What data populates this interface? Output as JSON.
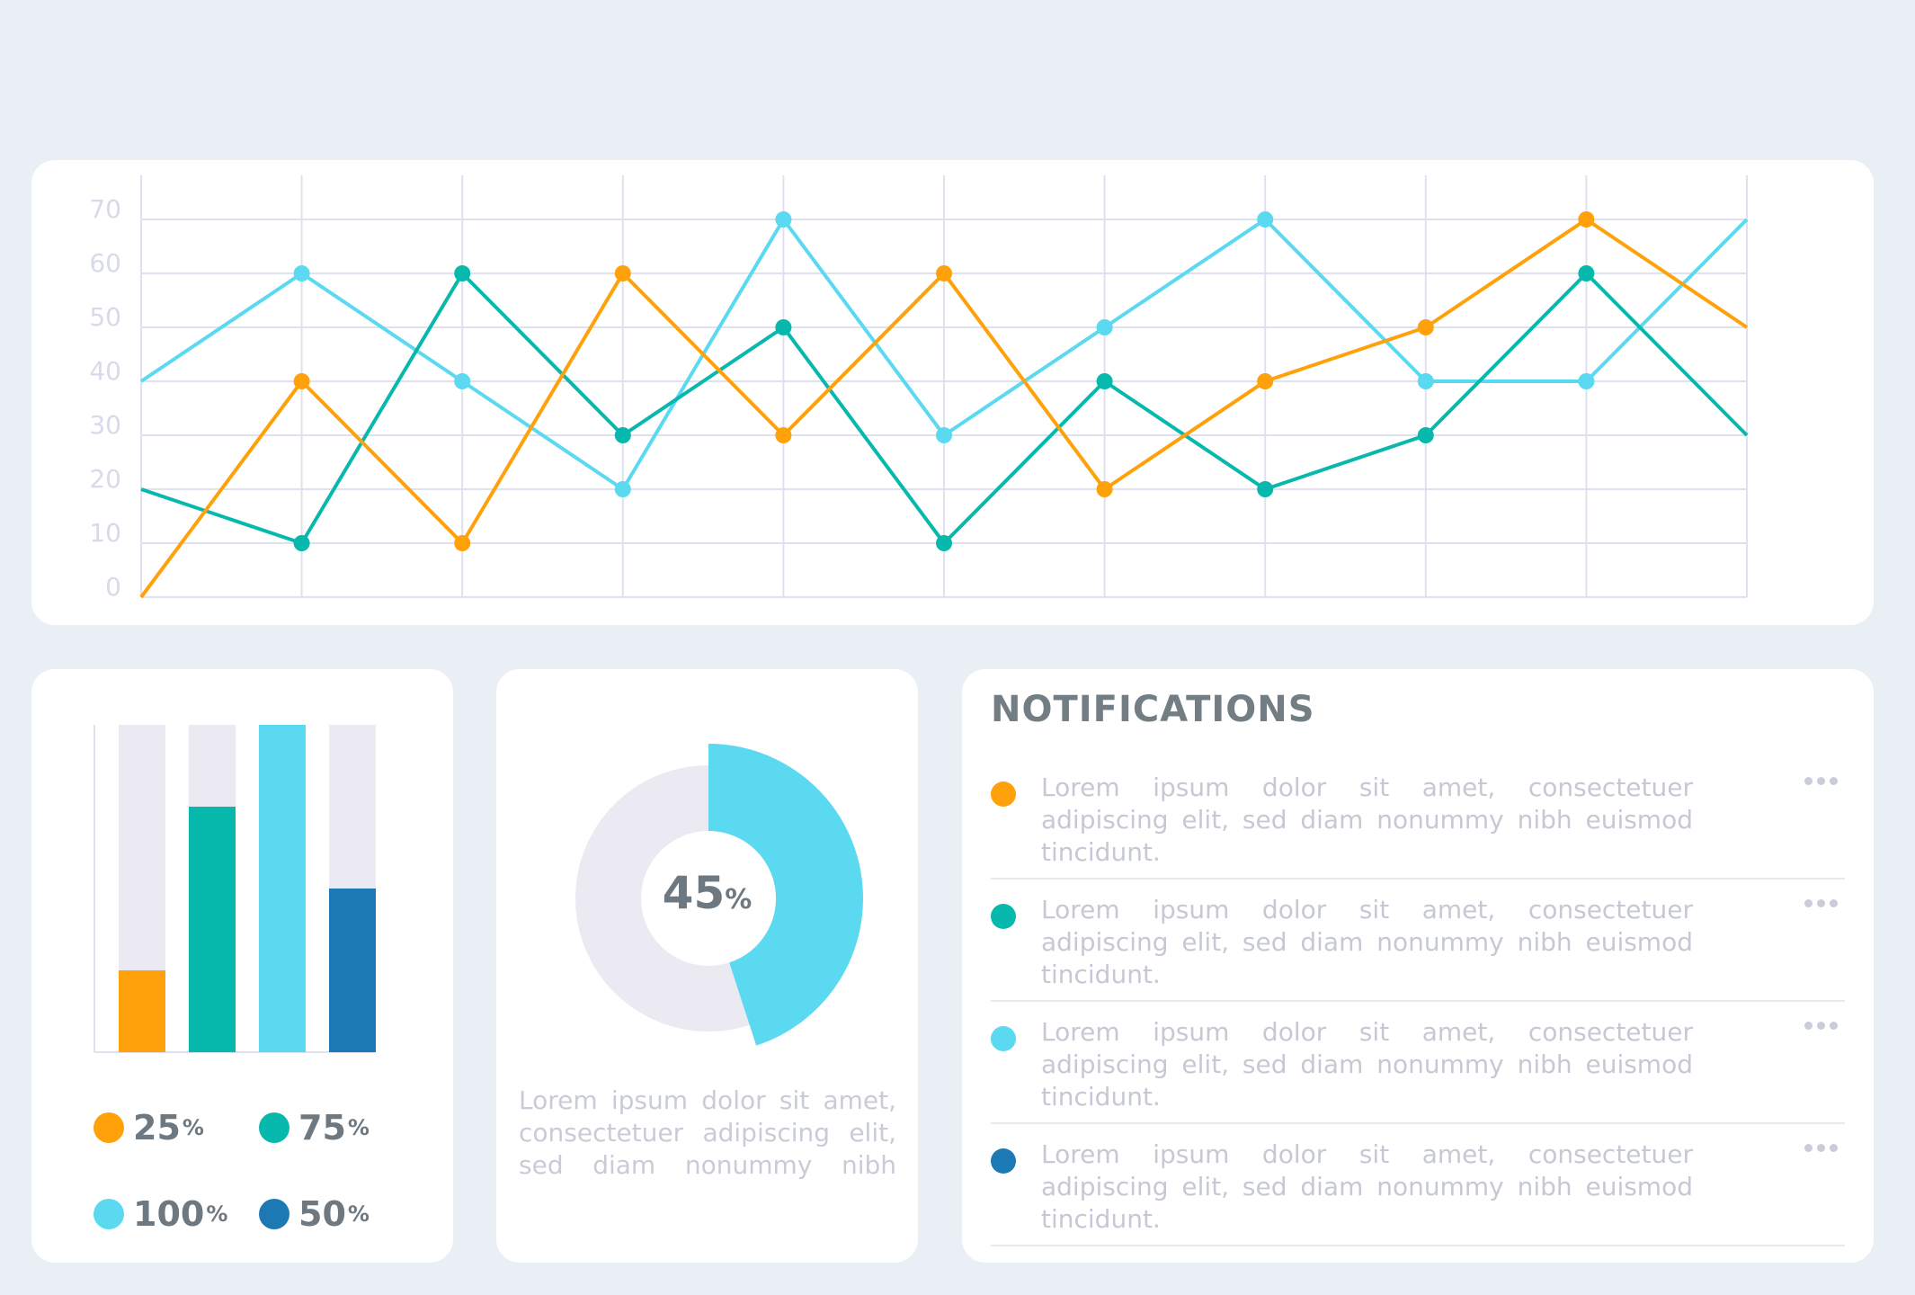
{
  "colors": {
    "background": "#eaeff6",
    "card": "#ffffff",
    "grid": "#dfe1ee",
    "orange": "#ffa10a",
    "teal": "#07b8ad",
    "sky": "#5ad9f1",
    "blue": "#1d79b4",
    "track": "#ebeaf3"
  },
  "chart_data": [
    {
      "type": "line",
      "x": [
        0,
        1,
        2,
        3,
        4,
        5,
        6,
        7,
        8,
        9,
        10
      ],
      "y_ticks": [
        "70",
        "60",
        "50",
        "40",
        "30",
        "20",
        "10",
        "0"
      ],
      "ylim": [
        0,
        70
      ],
      "grid": true,
      "series": [
        {
          "color": "#5ad9f1",
          "values": [
            40,
            60,
            40,
            20,
            70,
            30,
            50,
            70,
            40,
            40,
            70
          ]
        },
        {
          "color": "#07b8ad",
          "values": [
            20,
            10,
            60,
            30,
            50,
            10,
            40,
            20,
            30,
            60,
            30
          ]
        },
        {
          "color": "#ffa10a",
          "values": [
            0,
            40,
            10,
            60,
            30,
            60,
            20,
            40,
            50,
            70,
            50
          ]
        }
      ]
    },
    {
      "type": "bar",
      "categories": [
        "25%",
        "75%",
        "100%",
        "50%"
      ],
      "values": [
        25,
        75,
        100,
        50
      ],
      "ylim": [
        0,
        100
      ],
      "colors": [
        "#ffa10a",
        "#07b8ad",
        "#5ad9f1",
        "#1d79b4"
      ]
    },
    {
      "type": "pie",
      "values": [
        45,
        55
      ],
      "colors": [
        "#5ad9f1",
        "#ebeaf3"
      ]
    }
  ],
  "legend": [
    {
      "value": "25",
      "unit": "%",
      "color": "#ffa10a"
    },
    {
      "value": "75",
      "unit": "%",
      "color": "#07b8ad"
    },
    {
      "value": "100",
      "unit": "%",
      "color": "#5ad9f1"
    },
    {
      "value": "50",
      "unit": "%",
      "color": "#1d79b4"
    }
  ],
  "donut": {
    "value": "45",
    "unit": "%",
    "caption": "Lorem ipsum dolor sit amet, consectetuer adipiscing elit, sed diam nonummy nibh"
  },
  "notifications": {
    "title": "NOTIFICATIONS",
    "items": [
      {
        "color": "#ffa10a",
        "text": "Lorem ipsum dolor sit amet, consectetuer adipiscing elit, sed diam nonummy nibh euismod tincidunt."
      },
      {
        "color": "#07b8ad",
        "text": "Lorem ipsum dolor sit amet, consectetuer adipiscing elit, sed diam nonummy nibh euismod tincidunt."
      },
      {
        "color": "#5ad9f1",
        "text": "Lorem ipsum dolor sit amet, consectetuer adipiscing elit, sed diam nonummy nibh euismod tincidunt."
      },
      {
        "color": "#1d79b4",
        "text": "Lorem ipsum dolor sit amet, consectetuer adipiscing elit, sed diam nonummy nibh euismod tincidunt."
      }
    ]
  }
}
